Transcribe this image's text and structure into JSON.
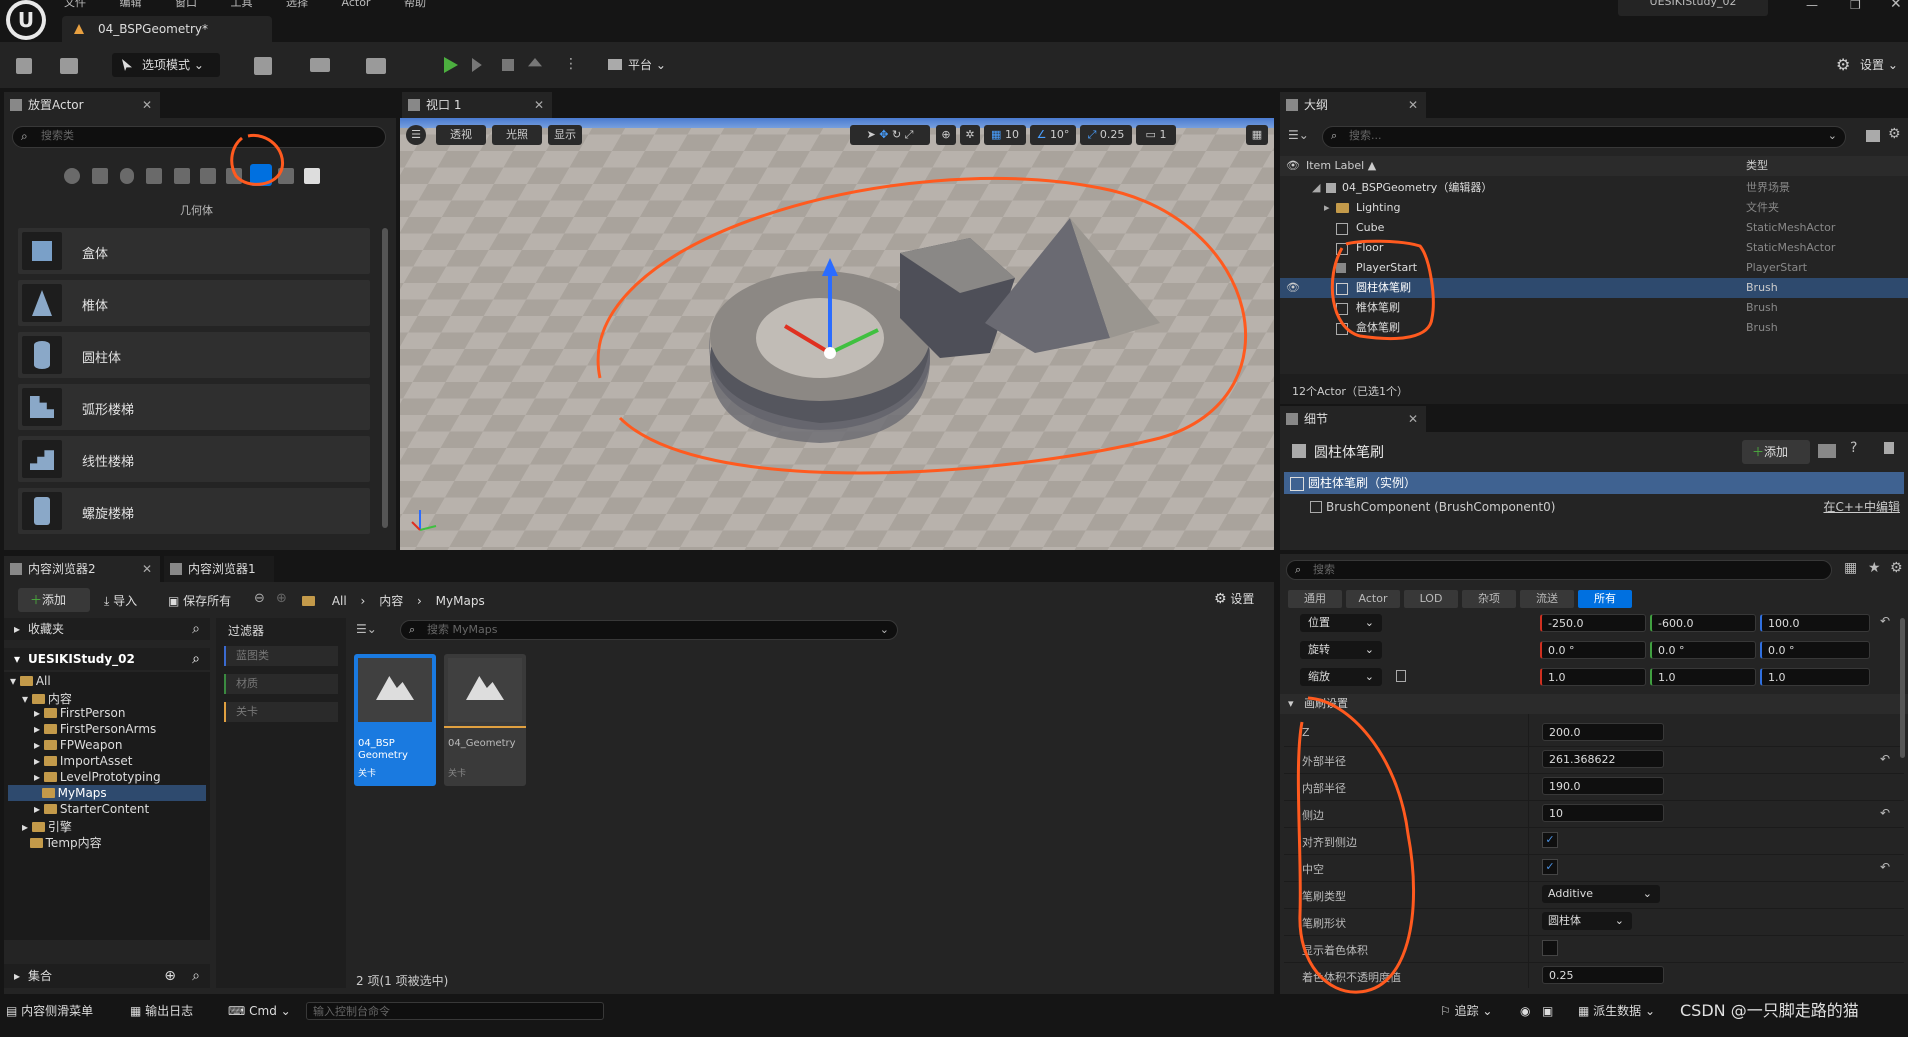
{
  "menu": {
    "items": [
      "文件",
      "编辑",
      "窗口",
      "工具",
      "选择",
      "Actor",
      "帮助"
    ],
    "project": "UESIKIStudy_02"
  },
  "level_tab": {
    "label": "04_BSPGeometry*"
  },
  "toolbar": {
    "select_mode": "选项模式",
    "platform": "平台",
    "settings": "设置"
  },
  "place_actor": {
    "tab": "放置Actor",
    "search_placeholder": "搜索类",
    "category": "几何体",
    "items": [
      {
        "label": "盒体"
      },
      {
        "label": "椎体"
      },
      {
        "label": "圆柱体"
      },
      {
        "label": "弧形楼梯"
      },
      {
        "label": "线性楼梯"
      },
      {
        "label": "螺旋楼梯"
      }
    ]
  },
  "viewport": {
    "tab": "视口 1",
    "perspective": "透视",
    "lit": "光照",
    "show": "显示",
    "grid": "10",
    "angle": "10°",
    "scale": "0.25",
    "camera": "1"
  },
  "outliner": {
    "tab": "大纲",
    "search_placeholder": "搜索...",
    "col_label": "Item Label ▲",
    "col_type": "类型",
    "rows": [
      {
        "label": "04_BSPGeometry（编辑器）",
        "type": "世界场景"
      },
      {
        "label": "Lighting",
        "type": "文件夹"
      },
      {
        "label": "Cube",
        "type": "StaticMeshActor"
      },
      {
        "label": "Floor",
        "type": "StaticMeshActor"
      },
      {
        "label": "PlayerStart",
        "type": "PlayerStart"
      },
      {
        "label": "圆柱体笔刷",
        "type": "Brush"
      },
      {
        "label": "椎体笔刷",
        "type": "Brush"
      },
      {
        "label": "盒体笔刷",
        "type": "Brush"
      }
    ],
    "status": "12个Actor（已选1个）"
  },
  "details": {
    "tab": "细节",
    "title": "圆柱体笔刷",
    "add": "添加",
    "instance": "圆柱体笔刷（实例）",
    "component": "BrushComponent (BrushComponent0)",
    "cpp_link": "在C++中编辑",
    "search_placeholder": "搜索",
    "filters": [
      "通用",
      "Actor",
      "LOD",
      "杂项",
      "流送",
      "所有"
    ],
    "transform": [
      {
        "label": "位置",
        "x": "-250.0",
        "y": "-600.0",
        "z": "100.0"
      },
      {
        "label": "旋转",
        "x": "0.0 °",
        "y": "0.0 °",
        "z": "0.0 °"
      },
      {
        "label": "缩放",
        "x": "1.0",
        "y": "1.0",
        "z": "1.0"
      }
    ],
    "section": "画刷设置",
    "props": [
      {
        "label": "Z",
        "value": "200.0"
      },
      {
        "label": "外部半径",
        "value": "261.368622"
      },
      {
        "label": "内部半径",
        "value": "190.0"
      },
      {
        "label": "侧边",
        "value": "10"
      },
      {
        "label": "对齐到侧边",
        "value": ""
      },
      {
        "label": "中空",
        "value": ""
      },
      {
        "label": "笔刷类型",
        "value": "Additive"
      },
      {
        "label": "笔刷形状",
        "value": "圆柱体"
      },
      {
        "label": "显示着色体积",
        "value": ""
      },
      {
        "label": "着色体积不透明度值",
        "value": "0.25"
      }
    ]
  },
  "content_browser": {
    "tab1": "内容浏览器2",
    "tab2": "内容浏览器1",
    "add": "添加",
    "import": "导入",
    "save_all": "保存所有",
    "path": [
      "All",
      "内容",
      "MyMaps"
    ],
    "settings": "设置",
    "favorites": "收藏夹",
    "project": "UESIKIStudy_02",
    "tree": [
      "All",
      "内容",
      "FirstPerson",
      "FirstPersonArms",
      "FPWeapon",
      "ImportAsset",
      "LevelPrototyping",
      "MyMaps",
      "StarterContent",
      "引擎",
      "Temp内容"
    ],
    "filters_label": "过滤器",
    "filters": [
      "蓝图类",
      "材质",
      "关卡"
    ],
    "search_placeholder": "搜索 MyMaps",
    "assets": [
      {
        "name": "04_BSP Geometry",
        "type": "关卡"
      },
      {
        "name": "04_Geometry",
        "type": "关卡"
      }
    ],
    "collections": "集合",
    "status": "2 项(1 项被选中)"
  },
  "statusbar": {
    "drawer": "内容侧滑菜单",
    "output": "输出日志",
    "cmd": "Cmd",
    "cmd_placeholder": "输入控制台命令",
    "trace": "追踪",
    "source": "派生数据",
    "watermark": "CSDN @一只脚走路的猫"
  },
  "colors": {
    "accent": "#0070e0",
    "annotation": "#ff5a1f",
    "selection": "#2e4a6e"
  }
}
